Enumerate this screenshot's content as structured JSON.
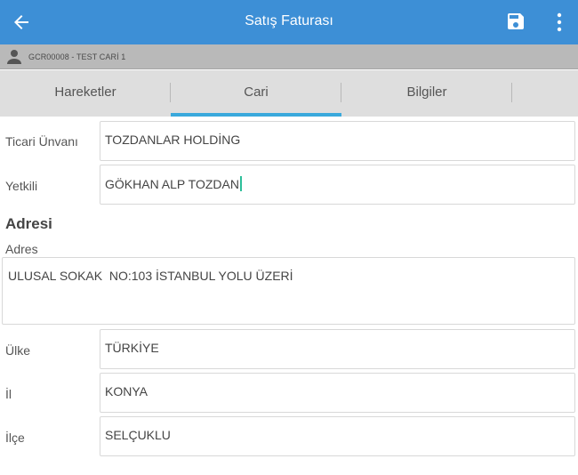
{
  "appbar": {
    "title": "Satış Faturası",
    "icons": {
      "back": "arrow-left-icon",
      "save": "floppy-disk-icon",
      "more": "more-vertical-icon"
    }
  },
  "subbar": {
    "account": "GCR00008 - TEST CARİ 1",
    "icon": "person-icon"
  },
  "tabs": [
    {
      "label": "Hareketler",
      "active": false
    },
    {
      "label": "Cari",
      "active": true
    },
    {
      "label": "Bilgiler",
      "active": false
    }
  ],
  "form": {
    "trade_name": {
      "label": "Ticari Ünvanı",
      "value": "TOZDANLAR HOLDİNG"
    },
    "contact": {
      "label": "Yetkili",
      "value": "GÖKHAN ALP TOZDAN"
    },
    "address_section": "Adresi",
    "address": {
      "label": "Adres",
      "value": "ULUSAL SOKAK  NO:103 İSTANBUL YOLU ÜZERİ"
    },
    "country": {
      "label": "Ülke",
      "value": "TÜRKİYE"
    },
    "province": {
      "label": "İl",
      "value": "KONYA"
    },
    "district": {
      "label": "İlçe",
      "value": "SELÇUKLU"
    }
  },
  "colors": {
    "appbar": "#3d8fd6",
    "tab_indicator": "#3aa9dc",
    "caret": "#2dbf9a"
  }
}
